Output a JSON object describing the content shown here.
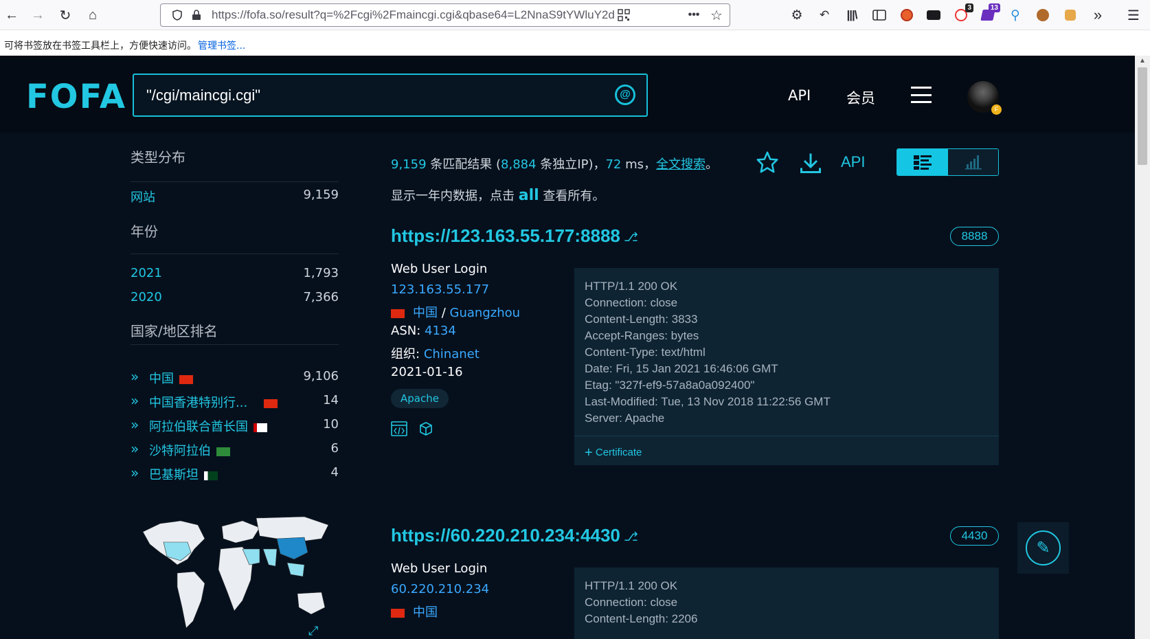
{
  "browser": {
    "url": "https://fofa.so/result?q=%2Fcgi%2Fmaincgi.cgi&qbase64=L2NnaS9tYWluY2d",
    "badges": {
      "ext1": "3",
      "ext2": "13"
    },
    "bookmarks_hint": "可将书签放在书签工具栏上，方便快速访问。",
    "bookmarks_manage": "管理书签..."
  },
  "header": {
    "logo": "FOFA",
    "search_query": "\"/cgi/maincgi.cgi\"",
    "nav": {
      "api": "API",
      "member": "会员"
    }
  },
  "sidebar": {
    "type_title": "类型分布",
    "types": [
      {
        "label": "网站",
        "count": "9,159"
      }
    ],
    "year_title": "年份",
    "years": [
      {
        "label": "2021",
        "count": "1,793"
      },
      {
        "label": "2020",
        "count": "7,366"
      }
    ],
    "country_title": "国家/地区排名",
    "countries": [
      {
        "label": "中国",
        "count": "9,106",
        "flag": "#de2910"
      },
      {
        "label": "中国香港特别行...",
        "count": "14",
        "flag": "#de2910"
      },
      {
        "label": "阿拉伯联合酋长国",
        "count": "10",
        "flag": "#00732f"
      },
      {
        "label": "沙特阿拉伯",
        "count": "6",
        "flag": "#006c35"
      },
      {
        "label": "巴基斯坦",
        "count": "4",
        "flag": "#01411c"
      }
    ]
  },
  "stats": {
    "total": "9,159",
    "t1": "条匹配结果 (",
    "ips": "8,884",
    "t2": "条独立IP)，",
    "ms": "72",
    "t3": "ms，",
    "fulltext": "全文搜索",
    "t4": "。",
    "line2_a": "显示一年内数据，点击",
    "line2_all": "all",
    "line2_b": "查看所有。",
    "api_label": "API"
  },
  "results": [
    {
      "url": "https://123.163.55.177:8888",
      "port": "8888",
      "title": "Web User Login",
      "ip": "123.163.55.177",
      "country": "中国",
      "city": "Guangzhou",
      "asn_label": "ASN:",
      "asn": "4134",
      "org_label": "组织:",
      "org": "Chinanet",
      "date": "2021-01-16",
      "tag": "Apache",
      "headers": [
        "HTTP/1.1 200 OK",
        "Connection: close",
        "Content-Length: 3833",
        "Accept-Ranges: bytes",
        "Content-Type: text/html",
        "Date: Fri, 15 Jan 2021 16:46:06 GMT",
        "Etag: \"327f-ef9-57a8a0a092400\"",
        "Last-Modified: Tue, 13 Nov 2018 11:22:56 GMT",
        "Server: Apache"
      ],
      "certificate": "Certificate"
    },
    {
      "url": "https://60.220.210.234:4430",
      "port": "4430",
      "title": "Web User Login",
      "ip": "60.220.210.234",
      "country": "中国",
      "headers": [
        "HTTP/1.1 200 OK",
        "Connection: close",
        "Content-Length: 2206"
      ]
    }
  ]
}
